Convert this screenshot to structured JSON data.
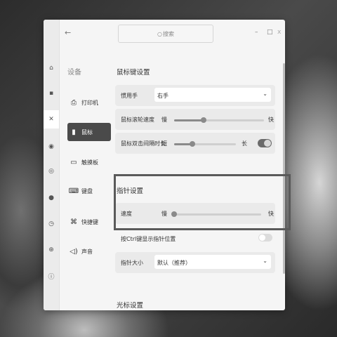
{
  "window": {
    "back_icon": "back-arrow-icon"
  },
  "search": {
    "placeholder": "搜索"
  },
  "controls": {
    "minimize": "–",
    "maximize": "□",
    "close": "x"
  },
  "rail": {
    "items": [
      "home-icon",
      "display-icon",
      "device-icon",
      "personalization-icon",
      "network-icon",
      "account-icon",
      "update-icon",
      "globe-icon",
      "info-icon"
    ],
    "active_index": 2
  },
  "nav": {
    "title": "设备",
    "items": [
      {
        "icon": "printer-icon",
        "label": "打印机"
      },
      {
        "icon": "mouse-icon",
        "label": "鼠标"
      },
      {
        "icon": "touchpad-icon",
        "label": "触摸板"
      },
      {
        "icon": "keyboard-icon",
        "label": "键盘"
      },
      {
        "icon": "shortcut-icon",
        "label": "快捷键"
      },
      {
        "icon": "sound-icon",
        "label": "声音"
      }
    ],
    "active_index": 1
  },
  "mouse_settings": {
    "title": "鼠标键设置",
    "hand": {
      "label": "惯用手",
      "value": "右手"
    },
    "scroll_speed": {
      "label": "鼠标滚轮速度",
      "min_label": "慢",
      "max_label": "快",
      "value_fraction": 0.33
    },
    "double_click": {
      "label": "鼠标双击间隔时长",
      "min_label": "短",
      "max_label": "长",
      "value_fraction": 0.3
    }
  },
  "pointer_settings": {
    "title": "指针设置",
    "speed": {
      "label": "速度",
      "min_label": "慢",
      "max_label": "快",
      "value_fraction": 0.0
    },
    "ctrl_show": {
      "label": "按Ctrl键显示指针位置",
      "enabled": false
    },
    "size": {
      "label": "指针大小",
      "value": "默认（推荐）"
    }
  },
  "cursor_settings": {
    "title": "光标设置"
  }
}
